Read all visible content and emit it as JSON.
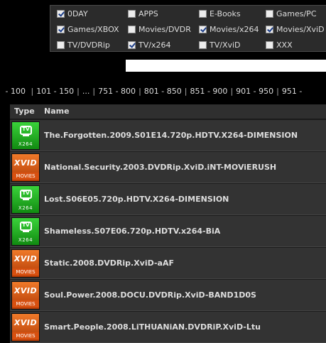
{
  "categories": [
    {
      "label": "0DAY",
      "checked": true
    },
    {
      "label": "APPS",
      "checked": false
    },
    {
      "label": "E-Books",
      "checked": false
    },
    {
      "label": "Games/PC",
      "checked": false
    },
    {
      "label": "Games/XBOX",
      "checked": true
    },
    {
      "label": "Movies/DVDR",
      "checked": false
    },
    {
      "label": "Movies/x264",
      "checked": true
    },
    {
      "label": "Movies/XviD",
      "checked": true
    },
    {
      "label": "TV/DVDRip",
      "checked": false
    },
    {
      "label": "TV/x264",
      "checked": true
    },
    {
      "label": "TV/XviD",
      "checked": false
    },
    {
      "label": "XXX",
      "checked": false
    }
  ],
  "search": {
    "value": ""
  },
  "pagination": {
    "lead": "- 100",
    "pages": [
      "101 - 150",
      "...",
      "751 - 800",
      "801 - 850",
      "851 - 900",
      "901 - 950",
      "951 -"
    ]
  },
  "table": {
    "headers": {
      "type": "Type",
      "name": "Name"
    },
    "rows": [
      {
        "type": "tv",
        "badge_top": "TV",
        "badge_sub": "X264",
        "name": "The.Forgotten.2009.S01E14.720p.HDTV.X264-DIMENSION"
      },
      {
        "type": "xvid",
        "badge_top": "XVID",
        "badge_sub": "MOVIES",
        "name": "National.Security.2003.DVDRip.XviD.iNT-MOViERUSH"
      },
      {
        "type": "tv",
        "badge_top": "TV",
        "badge_sub": "X264",
        "name": "Lost.S06E05.720p.HDTV.X264-DIMENSION"
      },
      {
        "type": "tv",
        "badge_top": "TV",
        "badge_sub": "X264",
        "name": "Shameless.S07E06.720p.HDTV.x264-BiA"
      },
      {
        "type": "xvid",
        "badge_top": "XVID",
        "badge_sub": "MOVIES",
        "name": "Static.2008.DVDRip.XviD-aAF"
      },
      {
        "type": "xvid",
        "badge_top": "XVID",
        "badge_sub": "MOVIES",
        "name": "Soul.Power.2008.DOCU.DVDRip.XviD-BAND1D0S"
      },
      {
        "type": "xvid",
        "badge_top": "XVID",
        "badge_sub": "MOVIES",
        "name": "Smart.People.2008.LiTHUANiAN.DVDRiP.XviD-Ltu"
      }
    ]
  },
  "colors": {
    "tv_badge": "#22b422",
    "xvid_badge": "#e0611a",
    "row_bg": "#333333"
  }
}
